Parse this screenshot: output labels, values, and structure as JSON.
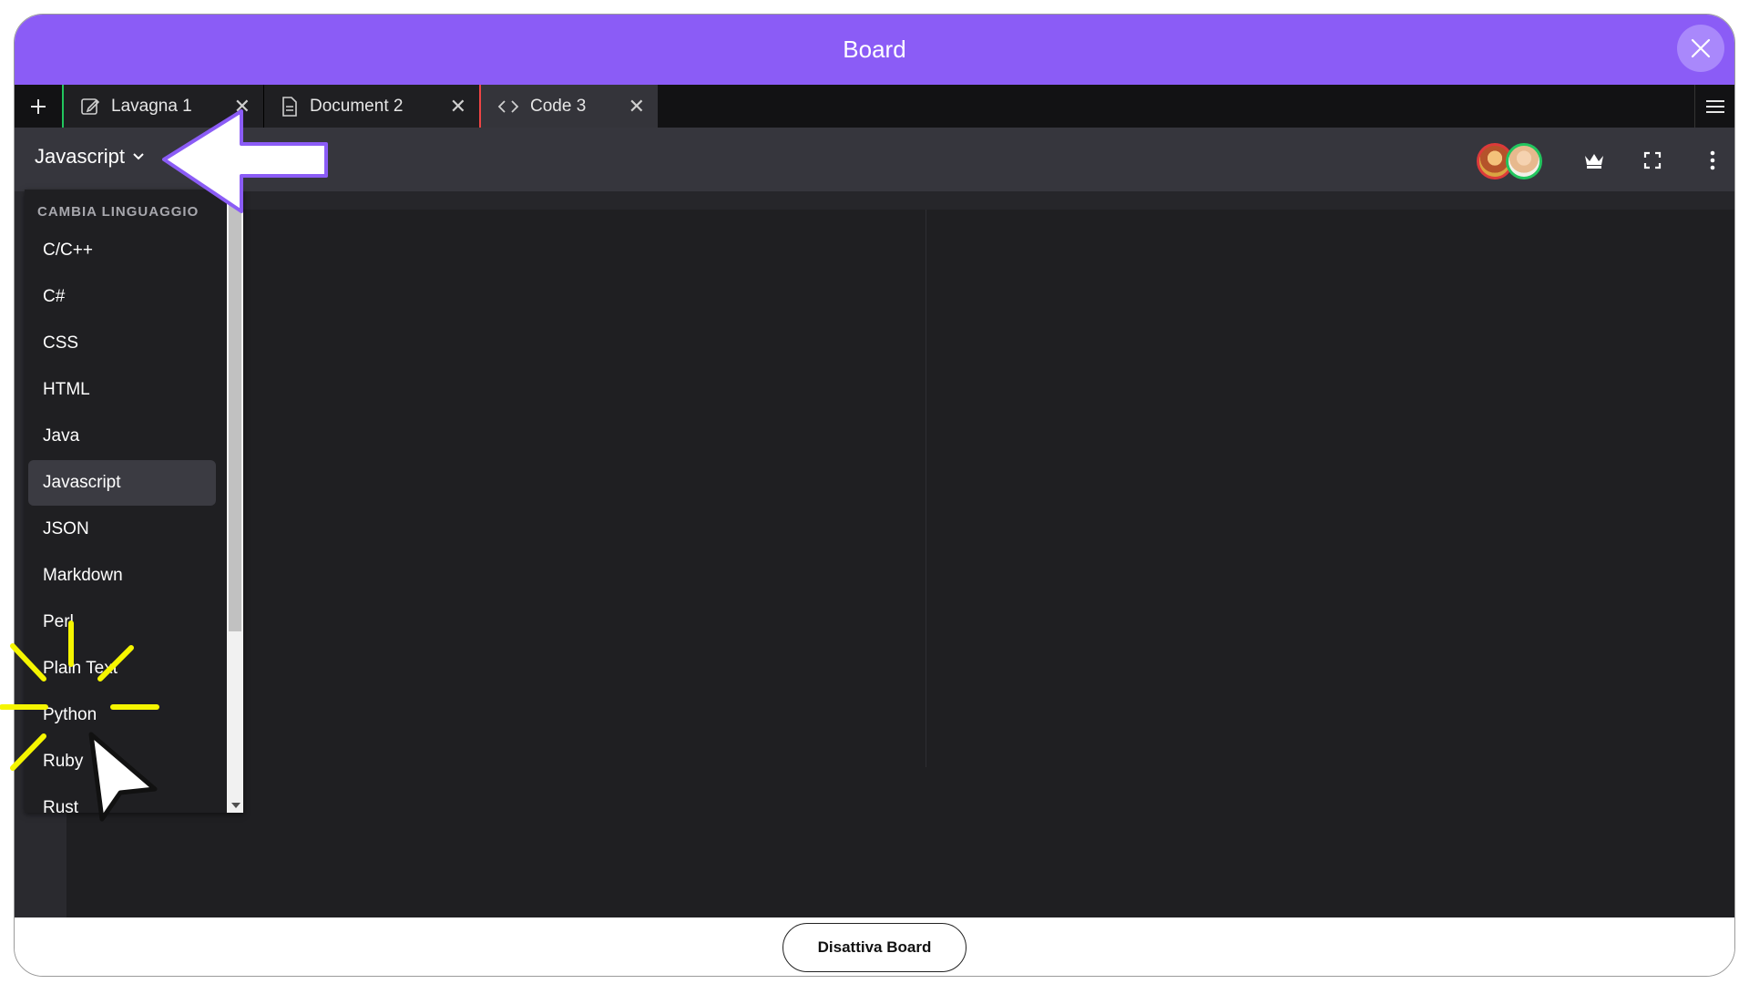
{
  "window": {
    "title": "Board"
  },
  "tabs": [
    {
      "label": "Lavagna 1",
      "icon": "edit-icon"
    },
    {
      "label": "Document 2",
      "icon": "document-icon"
    },
    {
      "label": "Code 3",
      "icon": "code-icon"
    }
  ],
  "toolbar": {
    "language": "Javascript"
  },
  "dropdown": {
    "header": "CAMBIA LINGUAGGIO",
    "selected": "Javascript",
    "items": [
      "C/C++",
      "C#",
      "CSS",
      "HTML",
      "Java",
      "Javascript",
      "JSON",
      "Markdown",
      "Perl",
      "Plain Text",
      "Python",
      "Ruby",
      "Rust"
    ]
  },
  "footer": {
    "deactivate_label": "Disattiva Board"
  },
  "colors": {
    "accent": "#8b5cf6",
    "tab_lavagna": "#22c55e",
    "tab_document": "#ef4444",
    "highlight": "#f5f500"
  }
}
